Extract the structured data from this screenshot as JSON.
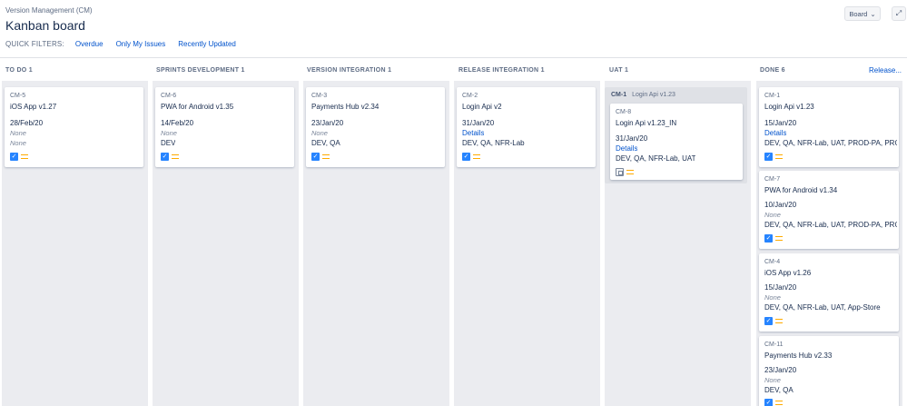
{
  "header": {
    "project": "Version Management (CM)",
    "title": "Kanban board",
    "board_button": "Board",
    "quick_filters_label": "QUICK FILTERS:",
    "quick_filters": [
      "Overdue",
      "Only My Issues",
      "Recently Updated"
    ],
    "release_link": "Release..."
  },
  "columns": [
    {
      "title": "TO DO 1"
    },
    {
      "title": "SPRINTS DEVELOPMENT 1"
    },
    {
      "title": "VERSION INTEGRATION 1"
    },
    {
      "title": "RELEASE INTEGRATION 1"
    },
    {
      "title": "UAT 1"
    },
    {
      "title": "DONE 6"
    }
  ],
  "cards": {
    "todo": {
      "key": "CM-5",
      "summary": "iOS App v1.27",
      "date": "28/Feb/20",
      "line1": "None",
      "line2": "None"
    },
    "sprints": {
      "key": "CM-6",
      "summary": "PWA for Android v1.35",
      "date": "14/Feb/20",
      "line1": "None",
      "line2": "DEV"
    },
    "version": {
      "key": "CM-3",
      "summary": "Payments Hub v2.34",
      "date": "23/Jan/20",
      "line1": "None",
      "line2": "DEV, QA"
    },
    "release": {
      "key": "CM-2",
      "summary": "Login Api v2",
      "date": "31/Jan/20",
      "line1": "Details",
      "line2": "DEV, QA, NFR-Lab"
    },
    "uat_parent": {
      "key": "CM-1",
      "summary": "Login Api v1.23"
    },
    "uat": {
      "key": "CM-8",
      "summary": "Login Api v1.23_IN",
      "date": "31/Jan/20",
      "line1": "Details",
      "line2": "DEV, QA, NFR-Lab, UAT"
    },
    "done": [
      {
        "key": "CM-1",
        "summary": "Login Api v1.23",
        "date": "15/Jan/20",
        "line1": "Details",
        "line2": "DEV, QA, NFR-Lab, UAT, PROD-PA, PROD-T"
      },
      {
        "key": "CM-7",
        "summary": "PWA for Android v1.34",
        "date": "10/Jan/20",
        "line1": "None",
        "line2": "DEV, QA, NFR-Lab, UAT, PROD-PA, PROD-IN"
      },
      {
        "key": "CM-4",
        "summary": "iOS App v1.26",
        "date": "15/Jan/20",
        "line1": "None",
        "line2": "DEV, QA, NFR-Lab, UAT, App-Store"
      },
      {
        "key": "CM-11",
        "summary": "Payments Hub v2.33",
        "date": "23/Jan/20",
        "line1": "None",
        "line2": "DEV, QA"
      }
    ]
  },
  "colors": {
    "link": "#0052cc",
    "column_bg": "#ebecf0",
    "checkbox": "#2684ff",
    "priority_medium": "#ffab00"
  },
  "icons": {
    "done_check": "✓",
    "board_chevron": "⌄",
    "expand": "⤢"
  }
}
